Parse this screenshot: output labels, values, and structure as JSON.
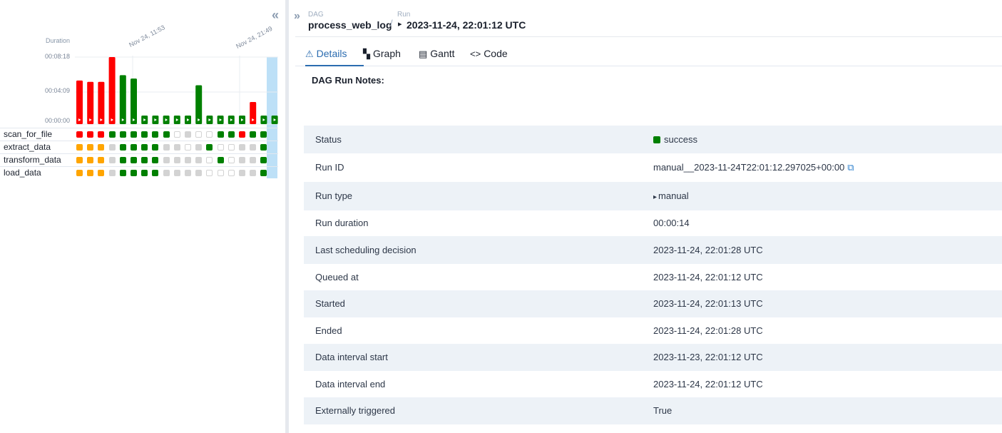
{
  "colors": {
    "success": "#008000",
    "failed": "#ff0000",
    "upstream_failed": "#ffa500",
    "no_status": "#d3d3d3",
    "empty": "#ffffff",
    "selected": "#bde0f7",
    "accent": "#2b6cb0"
  },
  "grid": {
    "collapse_icon": "«",
    "duration_label": "Duration",
    "yticks": [
      "00:08:18",
      "00:04:09",
      "00:00:00"
    ],
    "date_ticks": [
      "Nov 24, 11:53",
      "Nov 24, 21:49"
    ],
    "task_names": [
      "scan_for_file",
      "extract_data",
      "transform_data",
      "load_data"
    ],
    "runs": [
      {
        "state": "failed",
        "duration_frac": 0.65
      },
      {
        "state": "failed",
        "duration_frac": 0.63
      },
      {
        "state": "failed",
        "duration_frac": 0.63
      },
      {
        "state": "failed",
        "duration_frac": 1.0
      },
      {
        "state": "success",
        "duration_frac": 0.73
      },
      {
        "state": "success",
        "duration_frac": 0.68
      },
      {
        "state": "success",
        "duration_frac": 0.12
      },
      {
        "state": "success",
        "duration_frac": 0.12
      },
      {
        "state": "success",
        "duration_frac": 0.12
      },
      {
        "state": "success",
        "duration_frac": 0.12
      },
      {
        "state": "success",
        "duration_frac": 0.12
      },
      {
        "state": "success",
        "duration_frac": 0.58
      },
      {
        "state": "success",
        "duration_frac": 0.12
      },
      {
        "state": "success",
        "duration_frac": 0.12
      },
      {
        "state": "success",
        "duration_frac": 0.12
      },
      {
        "state": "success",
        "duration_frac": 0.12
      },
      {
        "state": "failed",
        "duration_frac": 0.33
      },
      {
        "state": "success",
        "duration_frac": 0.12
      },
      {
        "state": "success",
        "duration_frac": 0.12
      }
    ],
    "task_states": [
      [
        "failed",
        "failed",
        "failed",
        "success",
        "success",
        "success",
        "success",
        "success",
        "success",
        "empty",
        "no_status",
        "empty",
        "empty",
        "success",
        "success",
        "failed",
        "success",
        "success"
      ],
      [
        "upstream_failed",
        "upstream_failed",
        "upstream_failed",
        "no_status",
        "success",
        "success",
        "success",
        "success",
        "no_status",
        "no_status",
        "empty",
        "no_status",
        "success",
        "empty",
        "empty",
        "no_status",
        "no_status",
        "success"
      ],
      [
        "upstream_failed",
        "upstream_failed",
        "upstream_failed",
        "no_status",
        "success",
        "success",
        "success",
        "success",
        "no_status",
        "no_status",
        "no_status",
        "no_status",
        "empty",
        "success",
        "empty",
        "no_status",
        "no_status",
        "success"
      ],
      [
        "upstream_failed",
        "upstream_failed",
        "upstream_failed",
        "no_status",
        "success",
        "success",
        "success",
        "success",
        "no_status",
        "no_status",
        "no_status",
        "no_status",
        "empty",
        "empty",
        "empty",
        "no_status",
        "no_status",
        "success"
      ]
    ]
  },
  "breadcrumb": {
    "expand_icon": "»",
    "dag_caption": "DAG",
    "dag_id": "process_web_log",
    "separator": "/",
    "run_caption": "Run",
    "run_icon": "▸",
    "run_value": "2023-11-24, 22:01:12 UTC"
  },
  "tabs": [
    {
      "icon": "⚠",
      "label": "Details",
      "active": true
    },
    {
      "icon": "▚",
      "label": "Graph",
      "active": false
    },
    {
      "icon": "▤",
      "label": "Gantt",
      "active": false
    },
    {
      "icon": "<>",
      "label": "Code",
      "active": false
    }
  ],
  "notes_title": "DAG Run Notes:",
  "details": [
    {
      "label": "Status",
      "value": "success"
    },
    {
      "label": "Run ID",
      "value": "manual__2023-11-24T22:01:12.297025+00:00"
    },
    {
      "label": "Run type",
      "value": "manual"
    },
    {
      "label": "Run duration",
      "value": "00:00:14"
    },
    {
      "label": "Last scheduling decision",
      "value": "2023-11-24, 22:01:28 UTC"
    },
    {
      "label": "Queued at",
      "value": "2023-11-24, 22:01:12 UTC"
    },
    {
      "label": "Started",
      "value": "2023-11-24, 22:01:13 UTC"
    },
    {
      "label": "Ended",
      "value": "2023-11-24, 22:01:28 UTC"
    },
    {
      "label": "Data interval start",
      "value": "2023-11-23, 22:01:12 UTC"
    },
    {
      "label": "Data interval end",
      "value": "2023-11-24, 22:01:12 UTC"
    },
    {
      "label": "Externally triggered",
      "value": "True"
    }
  ],
  "copy_icon": "⧉",
  "run_type_icon": "▸"
}
